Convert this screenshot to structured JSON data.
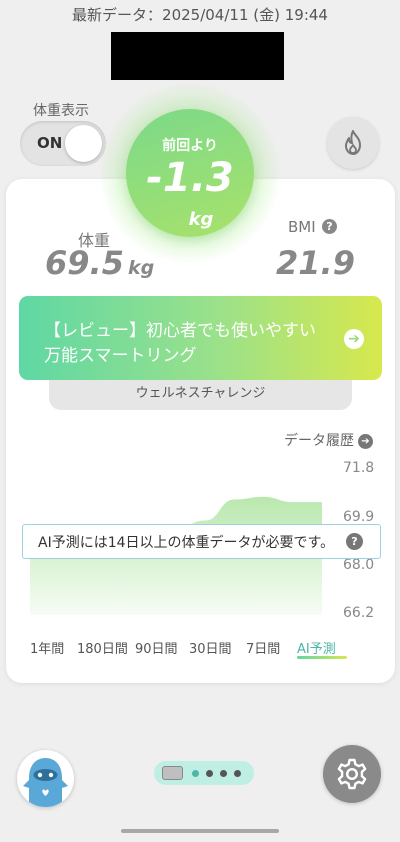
{
  "status": {
    "text": "最新データ：2025/04/11 (金) 19:44"
  },
  "weight_display": {
    "label": "体重表示",
    "toggle": "ON"
  },
  "change": {
    "label": "前回より",
    "value": "-1.3",
    "unit": "kg"
  },
  "weight": {
    "label": "体重",
    "value": "69.5",
    "unit": "kg"
  },
  "bmi": {
    "label": "BMI",
    "help": "?",
    "value": "21.9"
  },
  "banner": {
    "line1": "【レビュー】初心者でも使いやすい",
    "line2": "万能スマートリング",
    "arrow": "➔"
  },
  "wellness": {
    "label": "ウェルネスチャレンジ"
  },
  "history": {
    "label": "データ履歴",
    "arrow": "➔"
  },
  "chart_data": {
    "type": "area",
    "yticks": [
      "71.8",
      "69.9",
      "68.0",
      "66.2"
    ],
    "ylim": [
      66.2,
      71.8
    ],
    "x": [
      0,
      1,
      2,
      3,
      4,
      5,
      6,
      7,
      8,
      9,
      10
    ],
    "values": [
      69.3,
      69.2,
      69.3,
      69.5,
      69.6,
      69.5,
      69.8,
      70.6,
      70.7,
      70.5,
      70.5
    ],
    "color": "#a8e29a"
  },
  "notice": {
    "text": "AI予測には14日以上の体重データが必要です。",
    "help": "?"
  },
  "ranges": {
    "items": [
      "1年間",
      "180日間",
      "90日間",
      "30日間",
      "7日間",
      "AI予測"
    ],
    "active": "AI予測"
  },
  "colors": {
    "accent": "#7bd98a",
    "banner_start": "#5fd7a4",
    "banner_end": "#d7e84d"
  }
}
